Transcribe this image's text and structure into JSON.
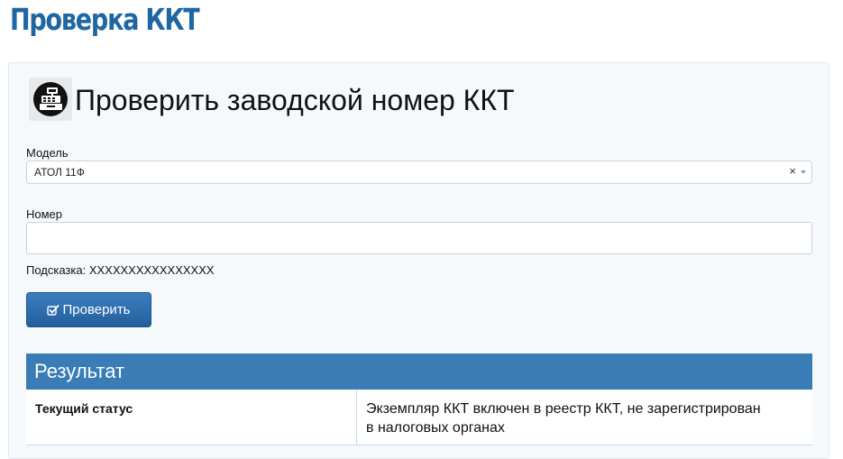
{
  "page": {
    "title": "Проверка ККТ"
  },
  "form": {
    "heading": "Проверить заводской номер ККТ",
    "icon": "cash-register-icon",
    "model_label": "Модель",
    "model_value": "АТОЛ 11Ф",
    "number_label": "Номер",
    "number_value": "",
    "hint": "Подсказка: XXXXXXXXXXXXXXXX",
    "submit_label": "Проверить",
    "submit_icon": "checkbox-icon"
  },
  "result": {
    "title": "Результат",
    "rows": [
      {
        "label": "Текущий статус",
        "value": "Экземпляр ККТ включен в реестр ККТ, не зарегистрирован в налоговых органах"
      }
    ]
  },
  "colors": {
    "title": "#1f67a3",
    "accent": "#3a7db6",
    "button": "#2a6aa9",
    "card_background": "#f6f9fc"
  }
}
